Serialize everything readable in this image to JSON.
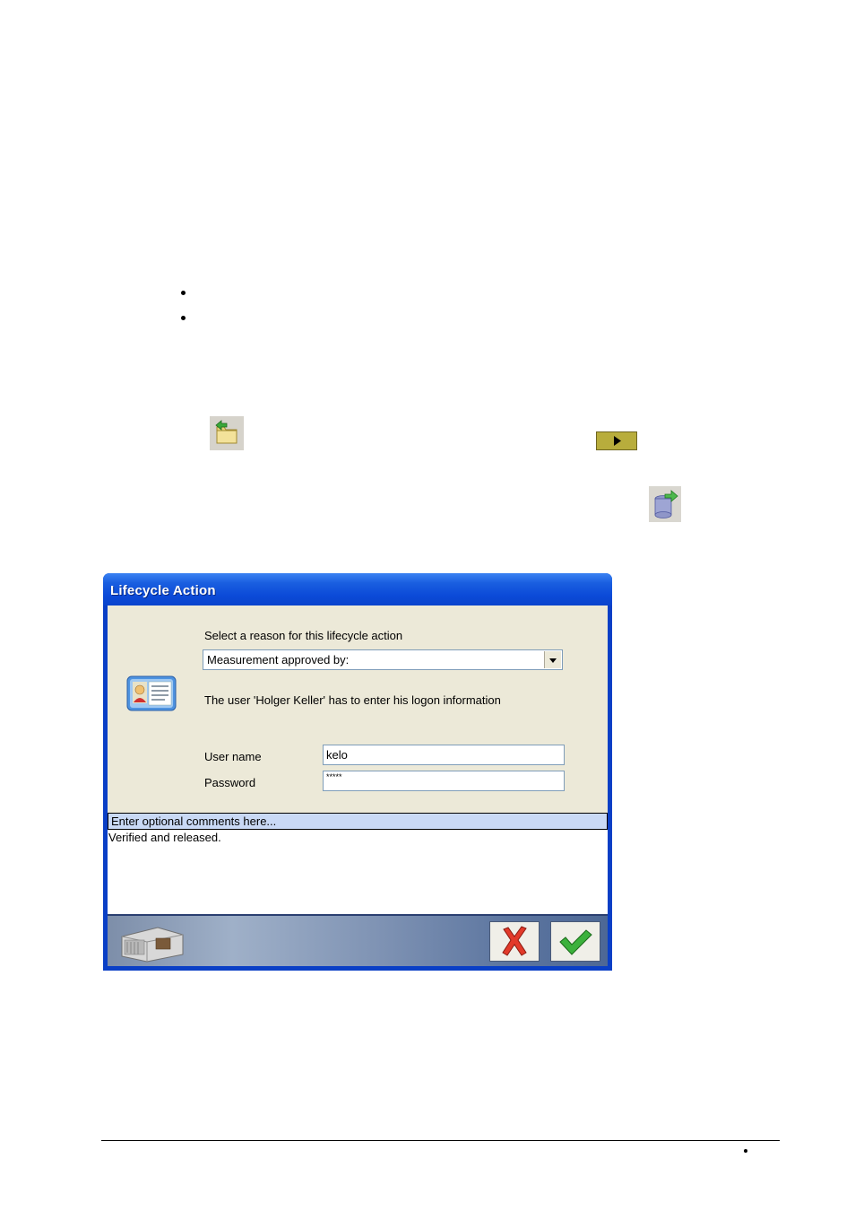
{
  "document": {
    "bullets": [
      "",
      ""
    ],
    "footer_bullet": ""
  },
  "icons": {
    "folder_back": "folder-back-icon",
    "play_bar": "play-arrow-icon",
    "db_export": "database-export-icon"
  },
  "dialog": {
    "title": "Lifecycle Action",
    "reason_label": "Select a reason for this lifecycle action",
    "reason_selected": "Measurement approved by:",
    "user_message": "The user 'Holger Keller' has  to  enter  his  logon  information",
    "username_label": "User name",
    "username_value": "kelo",
    "password_label": "Password",
    "password_value": "*****",
    "comments_placeholder": "Enter optional comments here...",
    "comments_value": "Verified and released.",
    "colors": {
      "title_bar": "#0a44cc",
      "client_bg": "#ece9d8",
      "comments_header_bg": "#c9d9f5"
    }
  }
}
